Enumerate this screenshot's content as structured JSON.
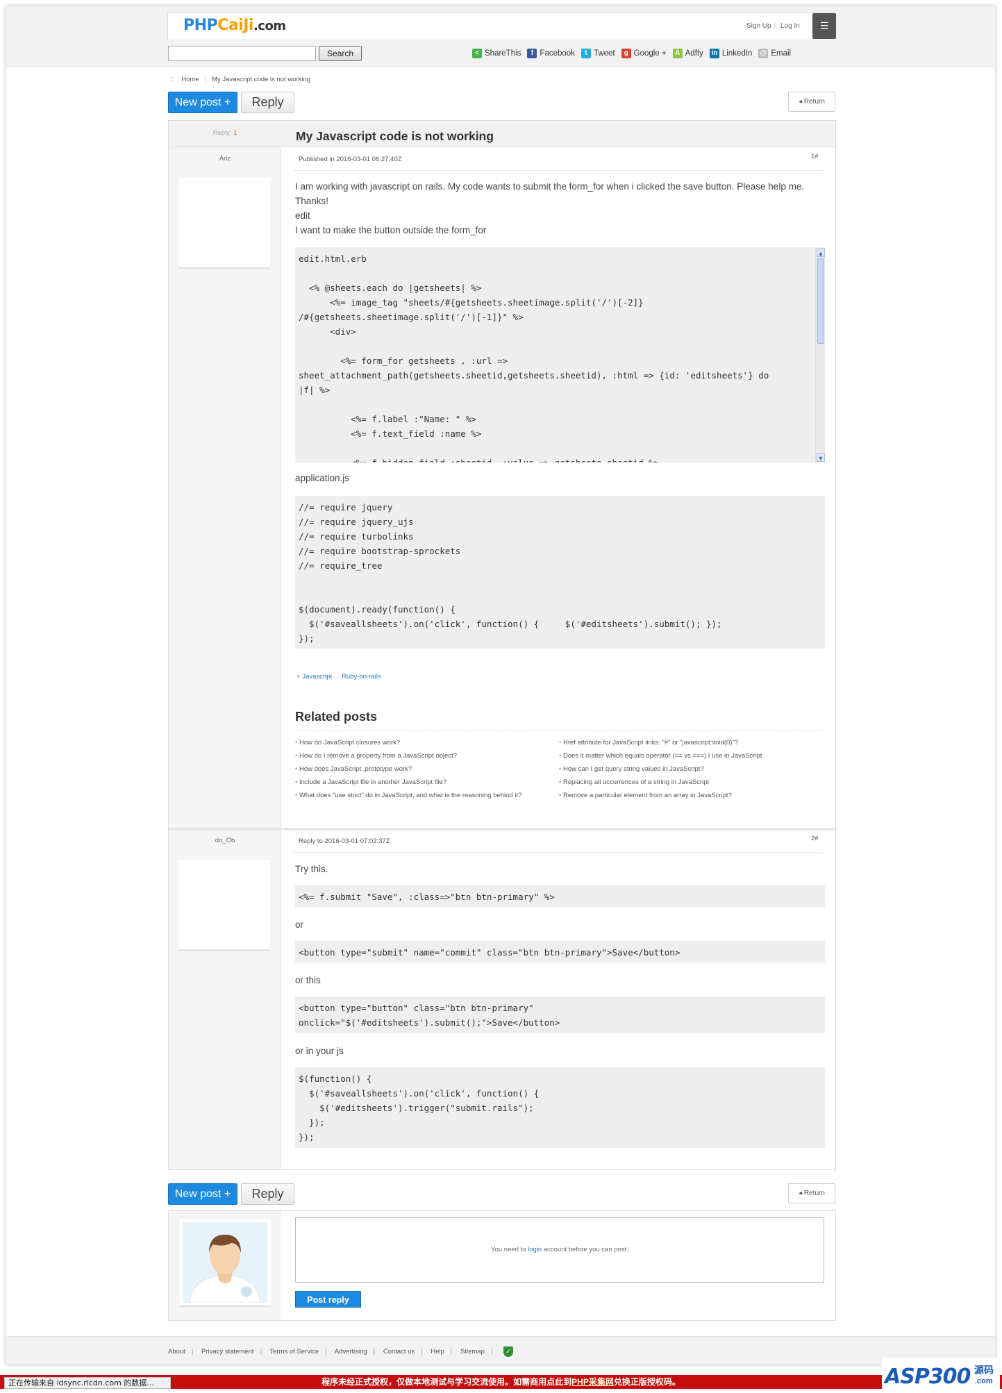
{
  "site": {
    "logo_part1": "PHP",
    "logo_part2": "CaiJi",
    "logo_part3": ".com",
    "sign_up": "Sign Up",
    "log_in": "Log In",
    "menu_icon": "list-icon"
  },
  "search": {
    "placeholder": "",
    "button": "Search"
  },
  "share": [
    {
      "label": "ShareThis",
      "icon": "sharethis-icon",
      "color": "#4caf50",
      "glyph": "<"
    },
    {
      "label": "Facebook",
      "icon": "facebook-icon",
      "color": "#3b5998",
      "glyph": "f"
    },
    {
      "label": "Tweet",
      "icon": "twitter-icon",
      "color": "#2aa9e0",
      "glyph": "t"
    },
    {
      "label": "Google +",
      "icon": "google-plus-icon",
      "color": "#d9452f",
      "glyph": "g"
    },
    {
      "label": "Adfty",
      "icon": "adfty-icon",
      "color": "#8bc34a",
      "glyph": "A"
    },
    {
      "label": "LinkedIn",
      "icon": "linkedin-icon",
      "color": "#0e76a8",
      "glyph": "in"
    },
    {
      "label": "Email",
      "icon": "email-icon",
      "color": "#bbbbbb",
      "glyph": "@"
    }
  ],
  "breadcrumb": {
    "home": "Home",
    "current": "My Javascript code is not working"
  },
  "toolbar": {
    "new_post": "New post +",
    "reply": "Reply",
    "return": "◂ Return"
  },
  "thread": {
    "reply_label": "Reply: ",
    "reply_count": "1",
    "title": "My Javascript code is not working"
  },
  "post1": {
    "author": "Ariz",
    "meta": "Published in 2016-03-01 06:27:40Z",
    "floor": "1#",
    "body1": "I am working with javascript on rails. My code wants to submit the form_for when i clicked the save button. Please help me. Thanks!",
    "body2": "edit",
    "body3": "I want to make the button outside the form_for",
    "code1": "edit.html.erb\n\n  <% @sheets.each do |getsheets| %>\n      <%= image_tag \"sheets/#{getsheets.sheetimage.split('/')[-2]}\n/#{getsheets.sheetimage.split('/')[-1]}\" %>\n      <div>\n\n        <%= form_for getsheets , :url =>\nsheet_attachment_path(getsheets.sheetid,getsheets.sheetid), :html => {id: 'editsheets'} do\n|f| %>\n\n          <%= f.label :\"Name: \" %>\n          <%= f.text_field :name %>\n\n          <%= f.hidden_field :sheetid, :value => getsheets.sheetid %>",
    "label_js": "application.js",
    "code2": "//= require jquery\n//= require jquery_ujs\n//= require turbolinks\n//= require bootstrap-sprockets\n//= require_tree\n\n\n$(document).ready(function() {\n  $('#saveallsheets').on('click', function() {     $('#editsheets').submit(); });\n});",
    "tags": [
      "Javascript",
      "Ruby-on-rails"
    ]
  },
  "related": {
    "title": "Related posts",
    "left": [
      "How do JavaScript closures work?",
      "How do I remove a property from a JavaScript object?",
      "How does JavaScript .prototype work?",
      "Include a JavaScript file in another JavaScript file?",
      "What does \"use strict\" do in JavaScript, and what is the reasoning behind it?"
    ],
    "right": [
      "Href attribute for JavaScript links: \"#\" or \"javascript:void(0)\"?",
      "Does it matter which equals operator (== vs ===) I use in JavaScript",
      "How can I get query string values in JavaScript?",
      "Replacing all occurrences of a string in JavaScript",
      "Remove a particular element from an array in JavaScript?"
    ]
  },
  "post2": {
    "author": "do_Ob",
    "meta": "Reply to 2016-03-01 07:02:37Z",
    "floor": "2#",
    "t1": "Try this.",
    "c1": "<%= f.submit \"Save\", :class=>\"btn btn-primary\" %>",
    "t2": "or",
    "c2": "<button type=\"submit\" name=\"commit\" class=\"btn btn-primary\">Save</button>",
    "t3": "or this",
    "c3": "<button type=\"button\" class=\"btn btn-primary\"\nonclick=\"$('#editsheets').submit();\">Save</button>",
    "t4": "or in your js",
    "c4": "$(function() {\n  $('#saveallsheets').on('click', function() {\n    $('#editsheets').trigger(\"submit.rails\");\n  });\n});"
  },
  "reply_box": {
    "prefix": "You need to ",
    "login": "login",
    "suffix": " account before you can post.",
    "button": "Post reply"
  },
  "footer": [
    "About",
    "Privacy statement",
    "Terms of Service",
    "Advertising",
    "Contact us",
    "Help",
    "Sitemap"
  ],
  "status": {
    "bar": "正在传输来自 idsync.rlcdn.com 的数据...",
    "banner_a": "程序未经正式授权，仅做本地测试与学习交流使用。如需商用点此到",
    "banner_link": "PHP采集网",
    "banner_b": "兑换正版授权码。"
  },
  "watermark": {
    "brand_a": "ASP",
    "brand_b": "300",
    "brand_c": "源码",
    "brand_d": ".com"
  }
}
